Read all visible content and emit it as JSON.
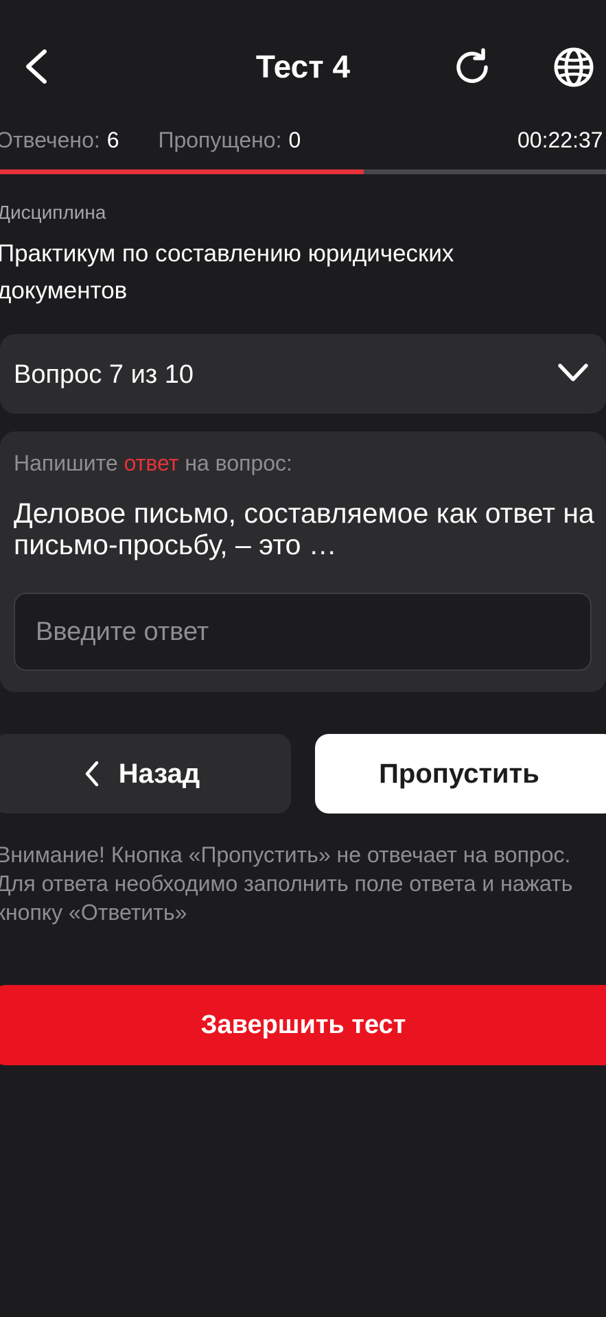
{
  "header": {
    "title": "Тест 4",
    "back_icon": "chevron-left-icon",
    "refresh_icon": "refresh-icon",
    "language_icon": "globe-icon"
  },
  "stats": {
    "answered_label": "Отвечено:",
    "answered_value": "6",
    "skipped_label": "Пропущено:",
    "skipped_value": "0",
    "timer": "00:22:37"
  },
  "progress": {
    "fraction": 0.6
  },
  "discipline": {
    "label": "Дисциплина",
    "name": "Практикум по составлению юридических документов"
  },
  "question_selector": {
    "label": "Вопрос 7 из 10",
    "chevron_icon": "chevron-down-icon"
  },
  "question": {
    "prompt_before": "Напишите ",
    "prompt_highlight": "ответ",
    "prompt_after": " на вопрос:",
    "text": "Деловое письмо, составляемое как ответ на письмо-просьбу, – это …",
    "answer_placeholder": "Введите ответ",
    "answer_value": ""
  },
  "buttons": {
    "back_label": "Назад",
    "skip_label": "Пропустить",
    "finish_label": "Завершить тест"
  },
  "notice": "Внимание! Кнопка «Пропустить» не отвечает на вопрос. Для ответа необходимо заполнить поле ответа и нажать кнопку «Ответить»",
  "colors": {
    "background": "#1c1c1e",
    "card": "#2c2c2e",
    "accent": "#e8323a",
    "finish_button": "#ea1420",
    "muted_text": "#8e8e93"
  }
}
